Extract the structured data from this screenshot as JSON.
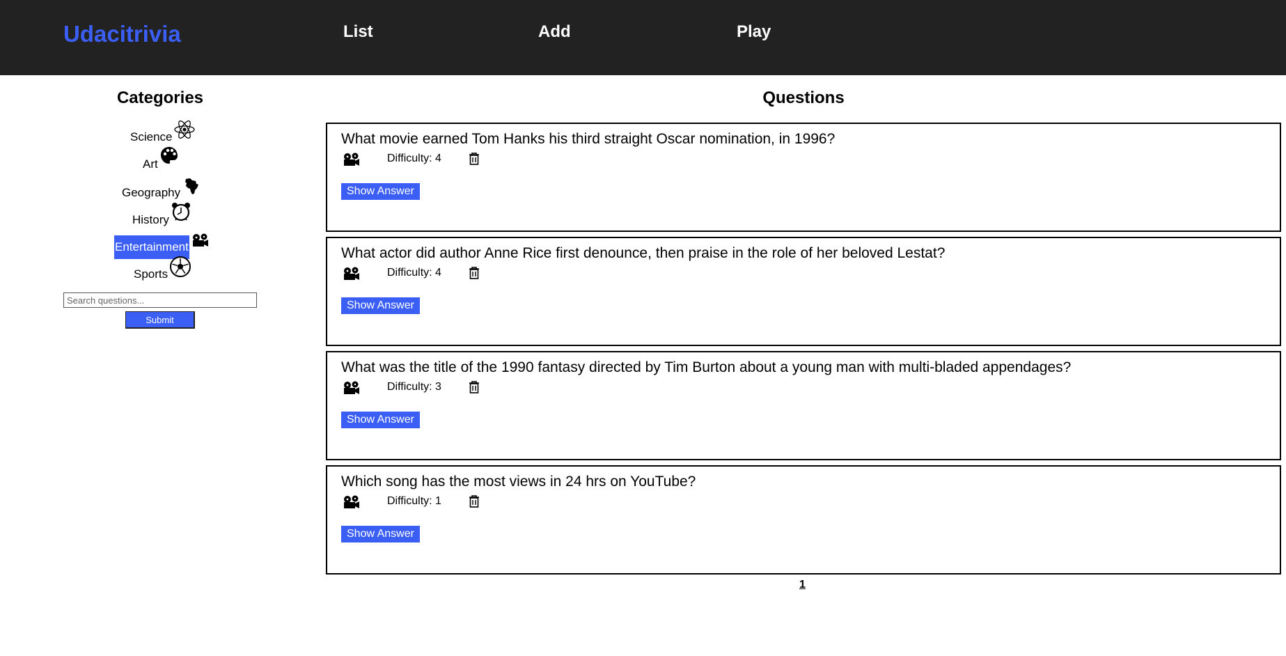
{
  "header": {
    "brand": "Udacitrivia",
    "nav": [
      {
        "label": "List"
      },
      {
        "label": "Add"
      },
      {
        "label": "Play"
      }
    ]
  },
  "sidebar": {
    "title": "Categories",
    "categories": [
      {
        "label": "Science",
        "icon": "atom-icon"
      },
      {
        "label": "Art",
        "icon": "palette-icon"
      },
      {
        "label": "Geography",
        "icon": "africa-icon"
      },
      {
        "label": "History",
        "icon": "alarm-clock-icon"
      },
      {
        "label": "Entertainment",
        "icon": "film-camera-icon",
        "selected": true
      },
      {
        "label": "Sports",
        "icon": "soccer-ball-icon"
      }
    ],
    "search": {
      "placeholder": "Search questions...",
      "value": ""
    },
    "submit_label": "Submit"
  },
  "main": {
    "title": "Questions",
    "questions": [
      {
        "text": "What movie earned Tom Hanks his third straight Oscar nomination, in 1996?",
        "difficulty": "Difficulty: 4",
        "category_icon": "film-camera-icon",
        "button": "Show Answer"
      },
      {
        "text": "What actor did author Anne Rice first denounce, then praise in the role of her beloved Lestat?",
        "difficulty": "Difficulty: 4",
        "category_icon": "film-camera-icon",
        "button": "Show Answer"
      },
      {
        "text": "What was the title of the 1990 fantasy directed by Tim Burton about a young man with multi-bladed appendages?",
        "difficulty": "Difficulty: 3",
        "category_icon": "film-camera-icon",
        "button": "Show Answer"
      },
      {
        "text": "Which song has the most views in 24 hrs on YouTube?",
        "difficulty": "Difficulty: 1",
        "category_icon": "film-camera-icon",
        "button": "Show Answer"
      }
    ],
    "pagination": {
      "current": "1"
    }
  },
  "colors": {
    "header_bg": "#222222",
    "accent": "#3b5ff5"
  }
}
